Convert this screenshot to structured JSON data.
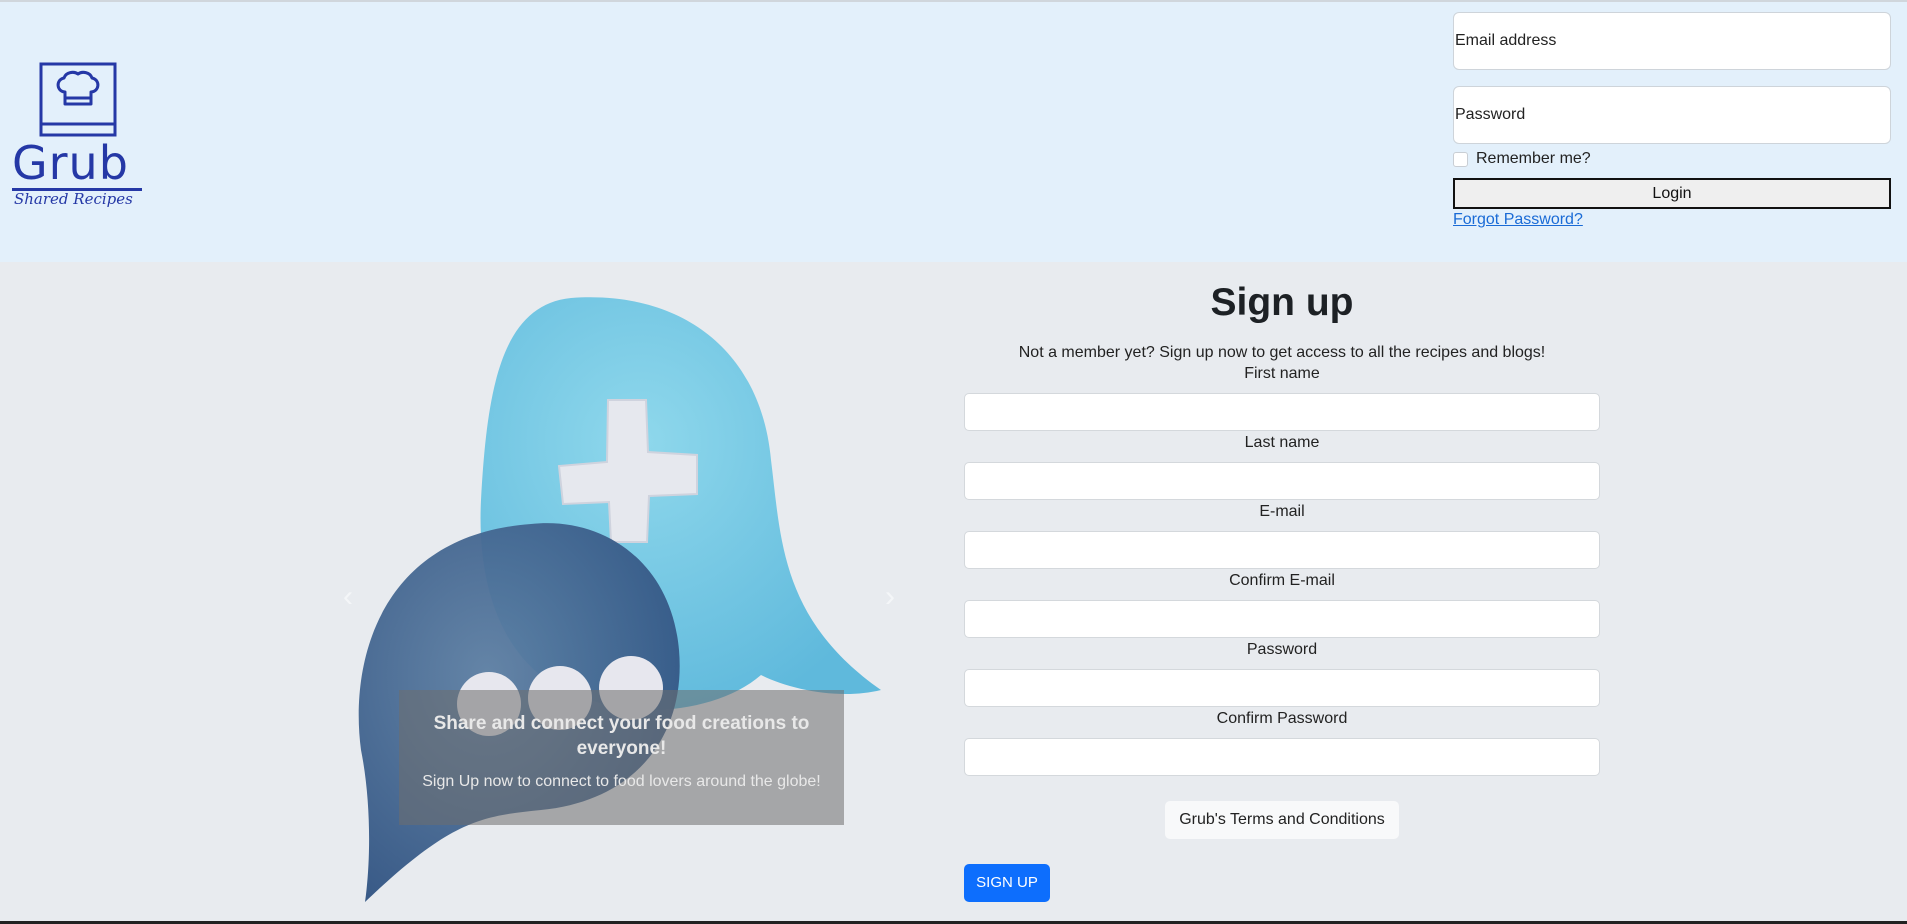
{
  "logo": {
    "brand": "Grub",
    "tagline": "Shared Recipes",
    "icon": "chef-hat-book-icon"
  },
  "login": {
    "email_placeholder": "Email address",
    "password_placeholder": "Password",
    "remember_label": "Remember me?",
    "login_button": "Login",
    "forgot_link": "Forgot Password?"
  },
  "carousel": {
    "heading": "Share and connect your food creations to everyone!",
    "subtext": "Sign Up now to connect to food lovers around the globe!",
    "prev_icon": "chevron-left-icon",
    "next_icon": "chevron-right-icon"
  },
  "signup": {
    "title": "Sign up",
    "intro": "Not a member yet? Sign up now to get access to all the recipes and blogs!",
    "fields": [
      {
        "label": "First name"
      },
      {
        "label": "Last name"
      },
      {
        "label": "E-mail"
      },
      {
        "label": "Confirm E-mail"
      },
      {
        "label": "Password"
      },
      {
        "label": "Confirm Password"
      }
    ],
    "terms_button": "Grub's Terms and Conditions",
    "submit_button": "SIGN UP"
  },
  "colors": {
    "brand": "#2538a6",
    "header_bg": "#e3f0fb",
    "primary": "#0d6efd",
    "link": "#1a6bd6"
  }
}
